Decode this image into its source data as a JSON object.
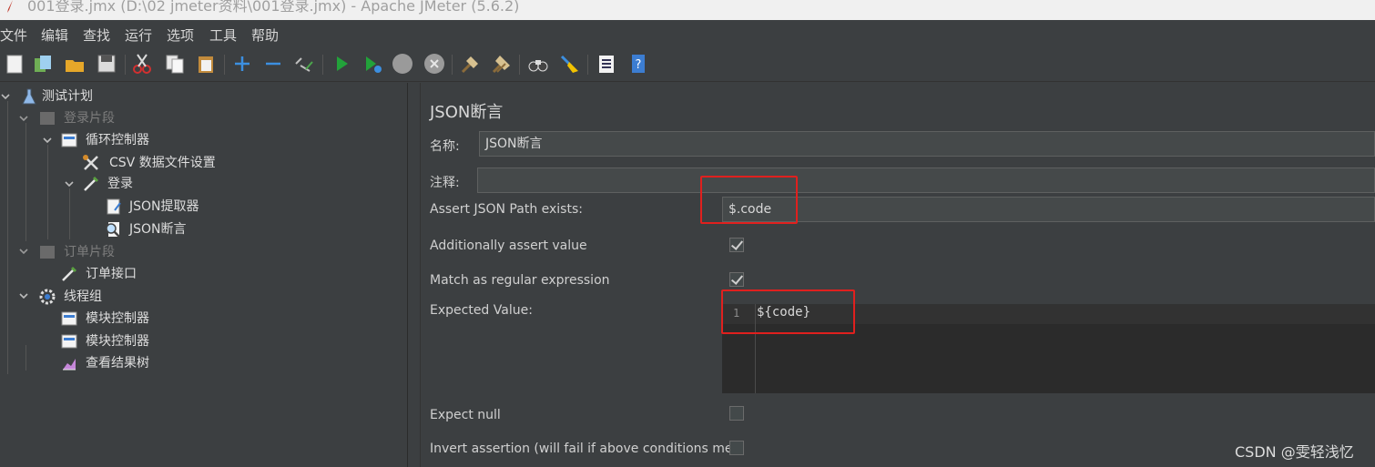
{
  "window": {
    "title": "001登录.jmx (D:\\02 jmeter资料\\001登录.jmx) - Apache JMeter (5.6.2)"
  },
  "menu": {
    "items": [
      "文件",
      "编辑",
      "查找",
      "运行",
      "选项",
      "工具",
      "帮助"
    ]
  },
  "toolbar": {
    "icons": [
      "new-icon",
      "templates-icon",
      "open-icon",
      "save-icon",
      "cut-icon",
      "copy-icon",
      "paste-icon",
      "expand-icon",
      "collapse-icon",
      "toggle-icon",
      "start-icon",
      "start-no-pause-icon",
      "stop-icon",
      "shutdown-icon",
      "clear-icon",
      "clear-all-icon",
      "search-icon",
      "reset-search-icon",
      "function-helper-icon",
      "help-icon"
    ]
  },
  "tree": {
    "nodes": [
      {
        "label": "测试计划",
        "icon": "flask-icon"
      },
      {
        "label": "登录片段",
        "icon": "fragment-icon"
      },
      {
        "label": "循环控制器",
        "icon": "controller-icon"
      },
      {
        "label": "CSV 数据文件设置",
        "icon": "tools-icon"
      },
      {
        "label": "登录",
        "icon": "pipette-icon"
      },
      {
        "label": "JSON提取器",
        "icon": "document-icon"
      },
      {
        "label": "JSON断言",
        "icon": "magnifier-icon"
      },
      {
        "label": "订单片段",
        "icon": "fragment-icon"
      },
      {
        "label": "订单接口",
        "icon": "pipette-icon"
      },
      {
        "label": "线程组",
        "icon": "gear-icon"
      },
      {
        "label": "模块控制器",
        "icon": "controller-icon"
      },
      {
        "label": "模块控制器",
        "icon": "controller-icon"
      },
      {
        "label": "查看结果树",
        "icon": "chart-icon"
      }
    ]
  },
  "panel": {
    "title": "JSON断言",
    "name_label": "名称:",
    "name_value": "JSON断言",
    "comment_label": "注释:",
    "comment_value": "",
    "path_label": "Assert JSON Path exists:",
    "path_value": "$.code",
    "additionally_label": "Additionally assert value",
    "additionally_checked": true,
    "regex_label": "Match as regular expression",
    "regex_checked": true,
    "expected_label": "Expected Value:",
    "expected_line_number": "1",
    "expected_value": "${code}",
    "expect_null_label": "Expect null",
    "expect_null_checked": false,
    "invert_label": "Invert assertion (will fail if above conditions met)",
    "invert_checked": false
  },
  "watermark": "CSDN @雯轻浅忆",
  "colors": {
    "highlight": "#e0201e",
    "selection": "#0d293e",
    "background": "#3c3f41"
  }
}
